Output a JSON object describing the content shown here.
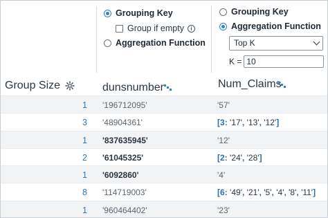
{
  "columns": {
    "group_size": {
      "label": "Group Size"
    },
    "dunsnumber": {
      "label": "dunsnumber"
    },
    "num_claims": {
      "label": "Num_Claims"
    }
  },
  "duns_options": {
    "grouping_key": "Grouping Key",
    "group_if_empty": "Group if empty",
    "aggregation_function": "Aggregation Function",
    "selected": "Grouping Key"
  },
  "claims_options": {
    "grouping_key": "Grouping Key",
    "aggregation_function": "Aggregation Function",
    "selected": "Aggregation Function",
    "function_select": "Top K",
    "k_label": "K =",
    "k_value": "10"
  },
  "rows": [
    {
      "size": "1",
      "duns": "'196712095'",
      "duns_bold": false,
      "claims_count": "",
      "claims": "'57'"
    },
    {
      "size": "3",
      "duns": "'48904361'",
      "duns_bold": false,
      "claims_count": "3",
      "claims": [
        "'17'",
        "'13'",
        "'12'"
      ]
    },
    {
      "size": "1",
      "duns": "'837635945'",
      "duns_bold": true,
      "claims_count": "",
      "claims": "'12'"
    },
    {
      "size": "2",
      "duns": "'61045325'",
      "duns_bold": true,
      "claims_count": "2",
      "claims": [
        "'24'",
        "'28'"
      ]
    },
    {
      "size": "1",
      "duns": "'6092860'",
      "duns_bold": true,
      "claims_count": "",
      "claims": "'4'"
    },
    {
      "size": "8",
      "duns": "'114719003'",
      "duns_bold": false,
      "claims_count": "6",
      "claims": [
        "'49'",
        "'21'",
        "'5'",
        "'4'",
        "'8'",
        "'11'"
      ]
    },
    {
      "size": "1",
      "duns": "'960464402'",
      "duns_bold": false,
      "claims_count": "",
      "claims": "'23'"
    }
  ],
  "colors": {
    "accent": "#2f82c7",
    "count_text": "#2f78b8",
    "alt_row": "#f1f3f5"
  }
}
